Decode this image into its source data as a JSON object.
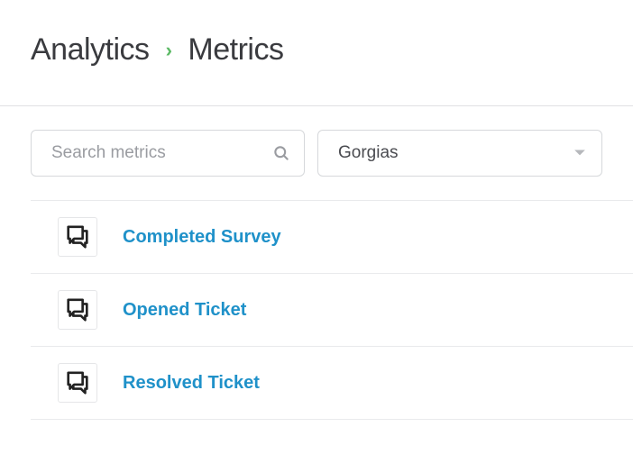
{
  "breadcrumb": {
    "parent": "Analytics",
    "current": "Metrics"
  },
  "search": {
    "placeholder": "Search metrics",
    "value": ""
  },
  "filter": {
    "selected": "Gorgias"
  },
  "metrics": [
    {
      "title": "Completed Survey"
    },
    {
      "title": "Opened Ticket"
    },
    {
      "title": "Resolved Ticket"
    }
  ]
}
